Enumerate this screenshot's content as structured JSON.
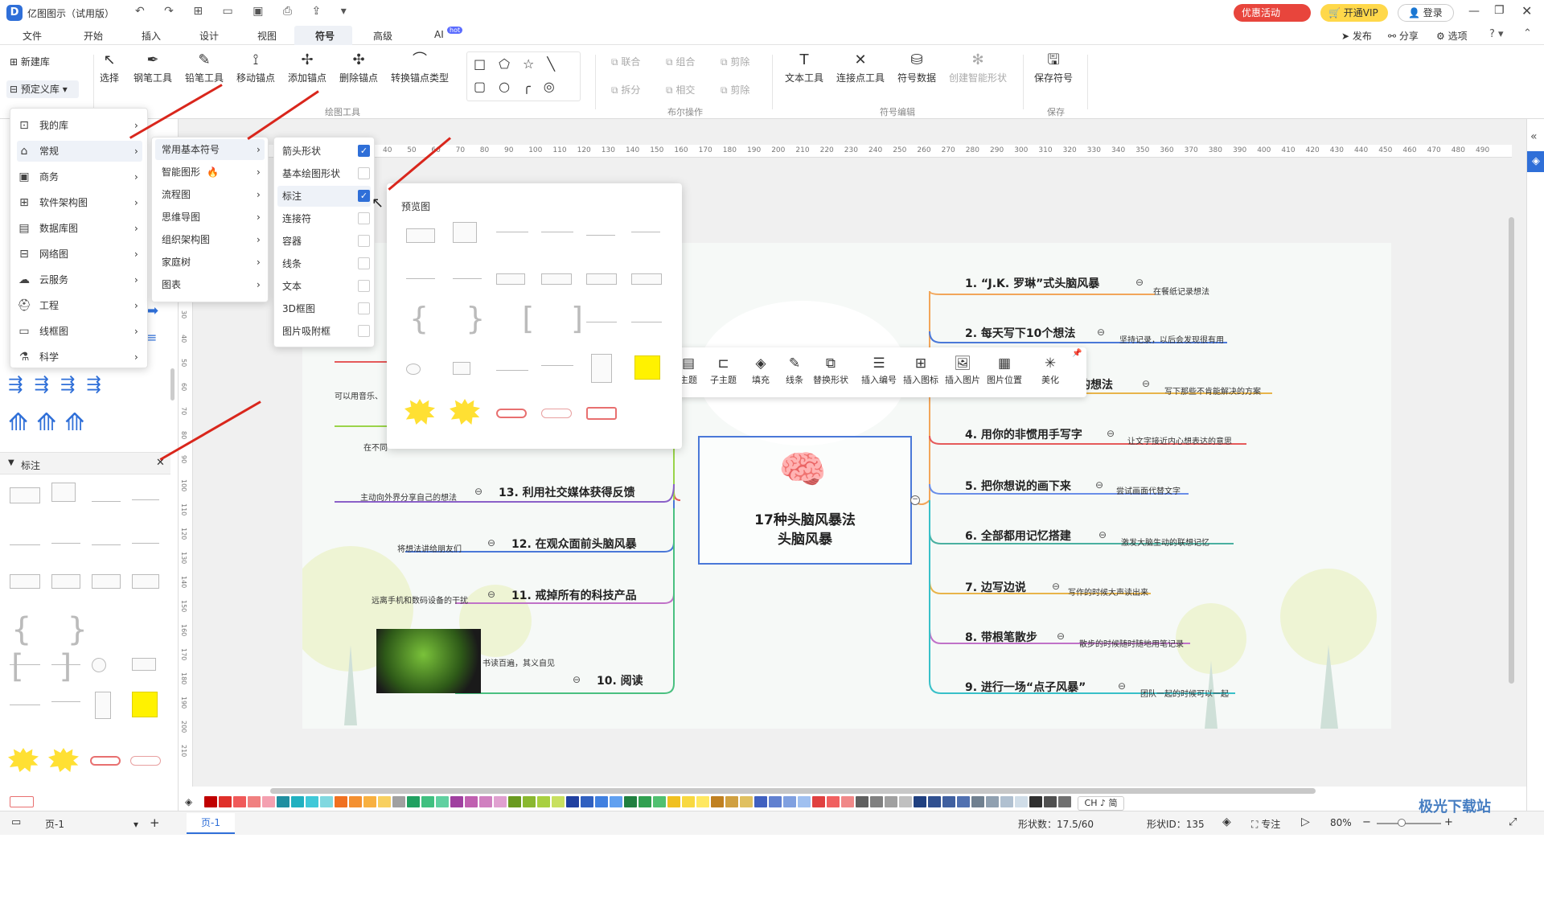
{
  "app": {
    "title": "亿图图示（试用版）",
    "promo": "优惠活动",
    "vip": "开通VIP",
    "login": "登录"
  },
  "menu": {
    "tabs": [
      "文件",
      "开始",
      "插入",
      "设计",
      "视图",
      "符号",
      "高级",
      "AI"
    ],
    "ai_badge": "hot",
    "right": [
      "发布",
      "分享",
      "选项"
    ]
  },
  "ribbon": {
    "new_lib": "新建库",
    "predefined_lib": "预定义库",
    "tools": [
      "选择",
      "钢笔工具",
      "铅笔工具",
      "移动锚点",
      "添加锚点",
      "删除锚点",
      "转换锚点类型"
    ],
    "group_draw": "绘图工具",
    "bool_ops": [
      "联合",
      "组合",
      "剪除",
      "拆分",
      "相交",
      "剪除"
    ],
    "group_bool": "布尔操作",
    "symbol_edit": [
      "文本工具",
      "连接点工具",
      "符号数据",
      "创建智能形状"
    ],
    "group_symbol": "符号编辑",
    "save_symbol": "保存符号",
    "group_save": "保存"
  },
  "library_menu": {
    "items": [
      "我的库",
      "常规",
      "商务",
      "软件架构图",
      "数据库图",
      "网络图",
      "云服务",
      "工程",
      "线框图",
      "科学"
    ]
  },
  "general_submenu": {
    "items": [
      "常用基本符号",
      "智能图形",
      "流程图",
      "思维导图",
      "组织架构图",
      "家庭树",
      "图表"
    ]
  },
  "symbol_checklist": {
    "items": [
      {
        "label": "箭头形状",
        "checked": true
      },
      {
        "label": "基本绘图形状",
        "checked": false
      },
      {
        "label": "标注",
        "checked": true
      },
      {
        "label": "连接符",
        "checked": false
      },
      {
        "label": "容器",
        "checked": false
      },
      {
        "label": "线条",
        "checked": false
      },
      {
        "label": "文本",
        "checked": false
      },
      {
        "label": "3D框图",
        "checked": false
      },
      {
        "label": "图片吸附框",
        "checked": false
      }
    ]
  },
  "preview": {
    "title": "预览图"
  },
  "panel": {
    "section": "标注"
  },
  "ruler": {
    "ticks": [
      "40",
      "50",
      "60",
      "70",
      "80",
      "90",
      "100",
      "110",
      "120",
      "130",
      "140",
      "150",
      "160",
      "170",
      "180",
      "190",
      "200",
      "210",
      "220",
      "230",
      "240",
      "250",
      "260",
      "270",
      "280",
      "290",
      "300",
      "310",
      "320",
      "330",
      "340",
      "350",
      "360",
      "370",
      "380",
      "390",
      "400",
      "410",
      "420",
      "430",
      "440",
      "450",
      "460",
      "470",
      "480",
      "490"
    ],
    "vticks": [
      "30",
      "40",
      "50",
      "60",
      "70",
      "80",
      "90",
      "100",
      "110",
      "120",
      "130",
      "140",
      "150",
      "160",
      "170",
      "180",
      "190",
      "200",
      "210"
    ]
  },
  "context_toolbar": {
    "buttons": [
      "主题",
      "子主题",
      "填充",
      "线条",
      "替换形状",
      "插入编号",
      "插入图标",
      "插入图片",
      "图片位置",
      "美化"
    ]
  },
  "mindmap": {
    "center_title": "17种头脑风暴法",
    "center_subtitle": "头脑风暴",
    "right_nodes": [
      {
        "title": "1. “J.K. 罗琳”式头脑风暴",
        "note": "在餐纸记录想法"
      },
      {
        "title": "2. 每天写下10个想法",
        "note": "坚持记录，以后会发现很有用"
      },
      {
        "title": "的想法",
        "note": "写下那些不肯能解决的方案"
      },
      {
        "title": "4. 用你的非惯用手写字",
        "note": "让文字接近内心想表达的意思"
      },
      {
        "title": "5. 把你想说的画下来",
        "note": "尝试画面代替文字"
      },
      {
        "title": "6. 全部都用记忆搭建",
        "note": "激发大脑生动的联想记忆"
      },
      {
        "title": "7. 边写边说",
        "note": "写作的时候大声读出来"
      },
      {
        "title": "8. 带根笔散步",
        "note": "散步的时候随时随地用笔记录"
      },
      {
        "title": "9. 进行一场“点子风暴”",
        "note": "团队一起的时候可以一起"
      }
    ],
    "left_nodes": [
      {
        "title": "13. 利用社交媒体获得反馈",
        "note": "主动向外界分享自己的想法"
      },
      {
        "title": "12. 在观众面前头脑风暴",
        "note": "将想法讲给朋友们"
      },
      {
        "title": "11. 戒掉所有的科技产品",
        "note": "远离手机和数码设备的干扰"
      },
      {
        "title": "10. 阅读",
        "note": "书读百遍，其义自见"
      }
    ],
    "left_partial": [
      "可以用音乐、",
      "在不同"
    ]
  },
  "status": {
    "page_tab": "页-1",
    "page_name": "页-1",
    "shape_count": "形状数：",
    "shape_count_value": "17.5/60",
    "shape_id": "形状ID：135",
    "focus": "专注",
    "zoom": "80%",
    "ime": "CH ♪ 简",
    "watermark": "极光下载站"
  }
}
